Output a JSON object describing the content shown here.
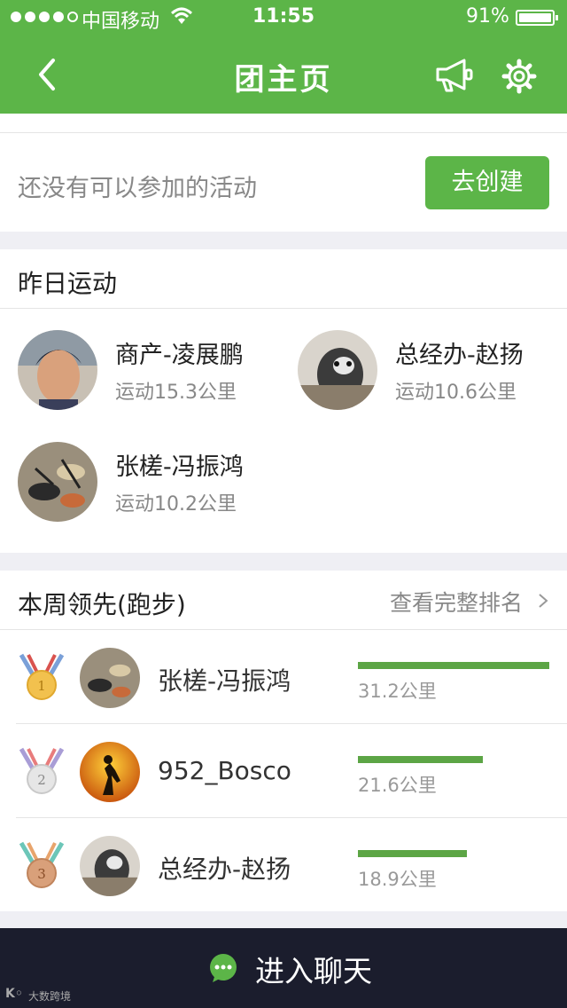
{
  "status_bar": {
    "carrier": "中国移动",
    "time": "11:55",
    "battery": "91%"
  },
  "nav": {
    "title": "团主页",
    "back_icon": "chevron-left-icon",
    "announce_icon": "megaphone-icon",
    "settings_icon": "gear-icon"
  },
  "activities": {
    "empty_text": "还没有可以参加的活动",
    "create_label": "去创建"
  },
  "yesterday": {
    "title": "昨日运动",
    "users": [
      {
        "name": "商产-凌展鹏",
        "distance": "运动15.3公里"
      },
      {
        "name": "总经办-赵扬",
        "distance": "运动10.6公里"
      },
      {
        "name": "张槎-冯振鸿",
        "distance": "运动10.2公里"
      }
    ]
  },
  "leaderboard": {
    "title": "本周领先(跑步)",
    "more_label": "查看完整排名",
    "rows": [
      {
        "rank": "1",
        "name": "张槎-冯振鸿",
        "distance": "31.2公里",
        "km": 31.2
      },
      {
        "rank": "2",
        "name": "952_Bosco",
        "distance": "21.6公里",
        "km": 21.6
      },
      {
        "rank": "3",
        "name": "总经办-赵扬",
        "distance": "18.9公里",
        "km": 18.9
      }
    ]
  },
  "chat": {
    "label": "进入聊天"
  },
  "watermark": {
    "text": "大数跨境"
  },
  "colors": {
    "brand_green": "#5cb548",
    "bar_green": "#5ca545",
    "chat_bg": "#1b1d2d"
  }
}
